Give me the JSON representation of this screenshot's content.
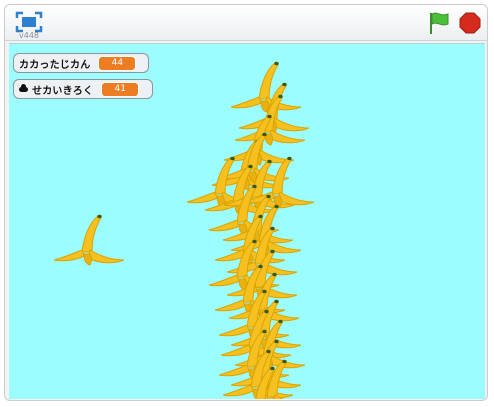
{
  "toolbar": {
    "version": "v448",
    "fullscreen_icon": "fullscreen-icon",
    "green_flag_icon": "green-flag-icon",
    "stop_icon": "stop-sign-icon",
    "flag_color": "#4cbf3a",
    "stop_color": "#d42b1e"
  },
  "stage": {
    "background": "#9cfdfe",
    "sprite_icon": "banana-peel-icon",
    "monitors": [
      {
        "label": "カカったじカん",
        "value": "44",
        "cloud": false
      },
      {
        "label": "せカいきろく",
        "value": "41",
        "cloud": true,
        "cloud_icon": "cloud-icon"
      }
    ]
  }
}
